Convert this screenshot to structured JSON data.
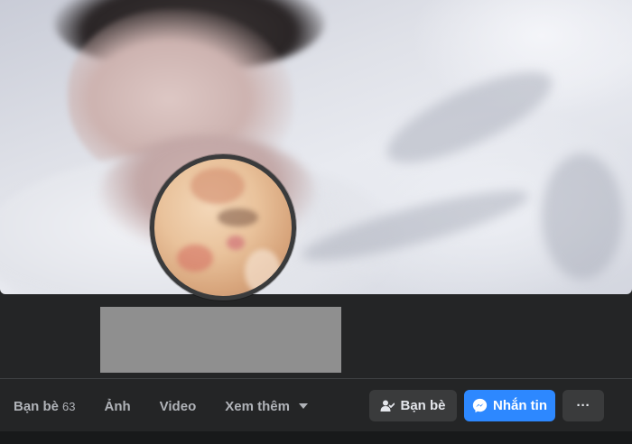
{
  "tabs": {
    "friends_label": "Bạn bè",
    "friends_count": "63",
    "photos_label": "Ảnh",
    "video_label": "Video",
    "more_label": "Xem thêm"
  },
  "actions": {
    "friends_button": "Bạn bè",
    "message_button": "Nhắn tin",
    "more_button": "···"
  },
  "icons": {
    "friends_button_icon": "person-check-icon",
    "message_button_icon": "messenger-icon",
    "more_caret_icon": "caret-down-icon"
  },
  "colors": {
    "background": "#242526",
    "button_secondary": "#3a3b3c",
    "button_primary": "#2d88ff",
    "text_secondary": "#b0b3b8",
    "name_redaction": "#8f8f8f"
  }
}
